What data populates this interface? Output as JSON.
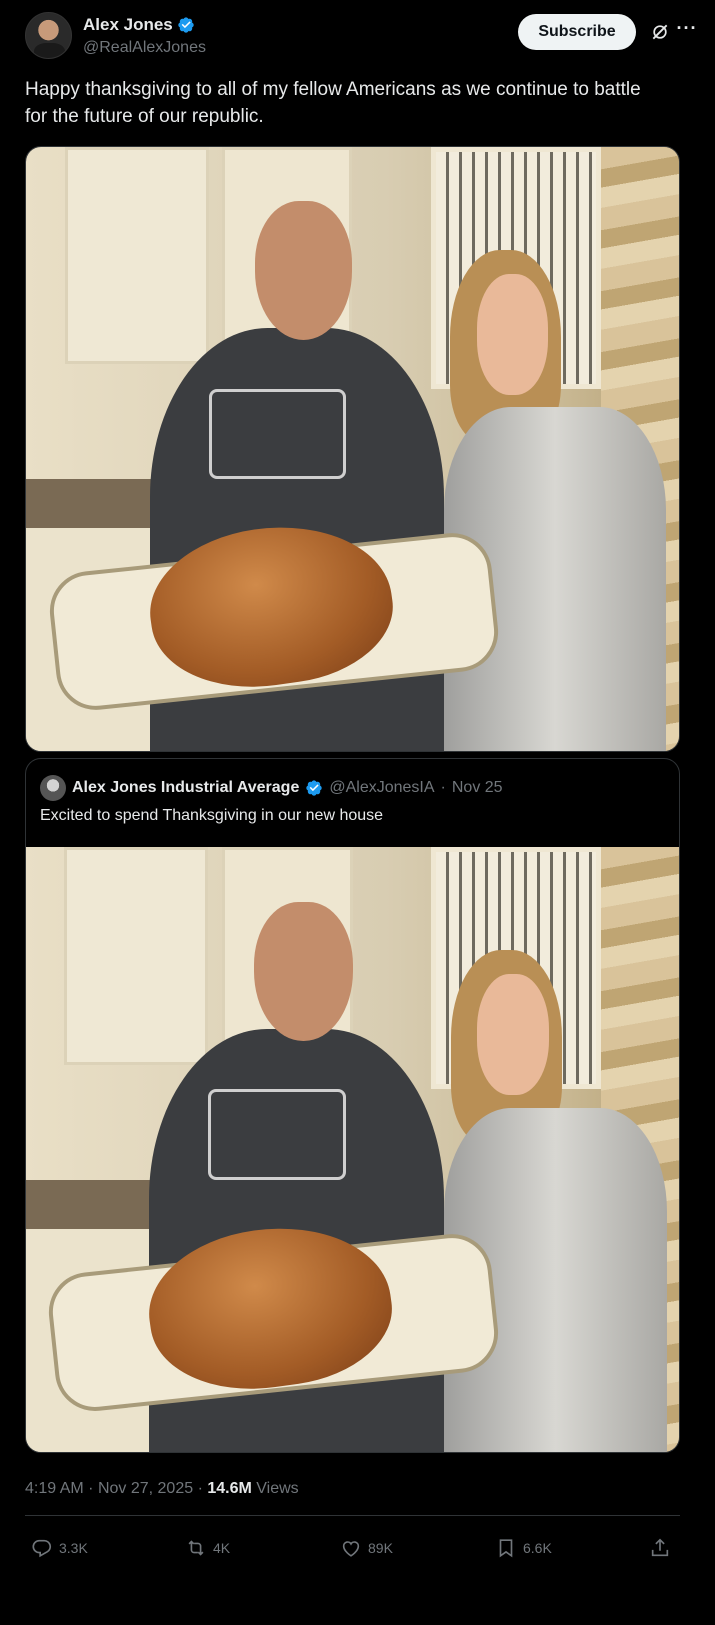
{
  "author": {
    "name": "Alex Jones",
    "handle": "@RealAlexJones",
    "subscribe_label": "Subscribe"
  },
  "tweet": {
    "text": "Happy thanksgiving to all of my fellow Americans as we continue to battle for the future of our republic."
  },
  "quoted": {
    "name": "Alex Jones Industrial Average",
    "handle": "@AlexJonesIA",
    "separator": "·",
    "date": "Nov 25",
    "text": "Excited to spend Thanksgiving in our new house"
  },
  "meta": {
    "time": "4:19 AM",
    "separator": "·",
    "date": "Nov 27, 2025",
    "views_count": "14.6M",
    "views_label": "Views"
  },
  "actions": {
    "replies": "3.3K",
    "reposts": "4K",
    "likes": "89K",
    "bookmarks": "6.6K"
  },
  "icons": {
    "verified": "verified-badge-icon",
    "grok": "grok-icon",
    "more": "more-icon",
    "reply": "reply-icon",
    "repost": "repost-icon",
    "like": "like-icon",
    "bookmark": "bookmark-icon",
    "share": "share-icon"
  },
  "colors": {
    "background": "#000000",
    "text": "#e7e9ea",
    "secondary": "#71767b",
    "verified": "#1d9bf0",
    "border": "#2f3336"
  }
}
